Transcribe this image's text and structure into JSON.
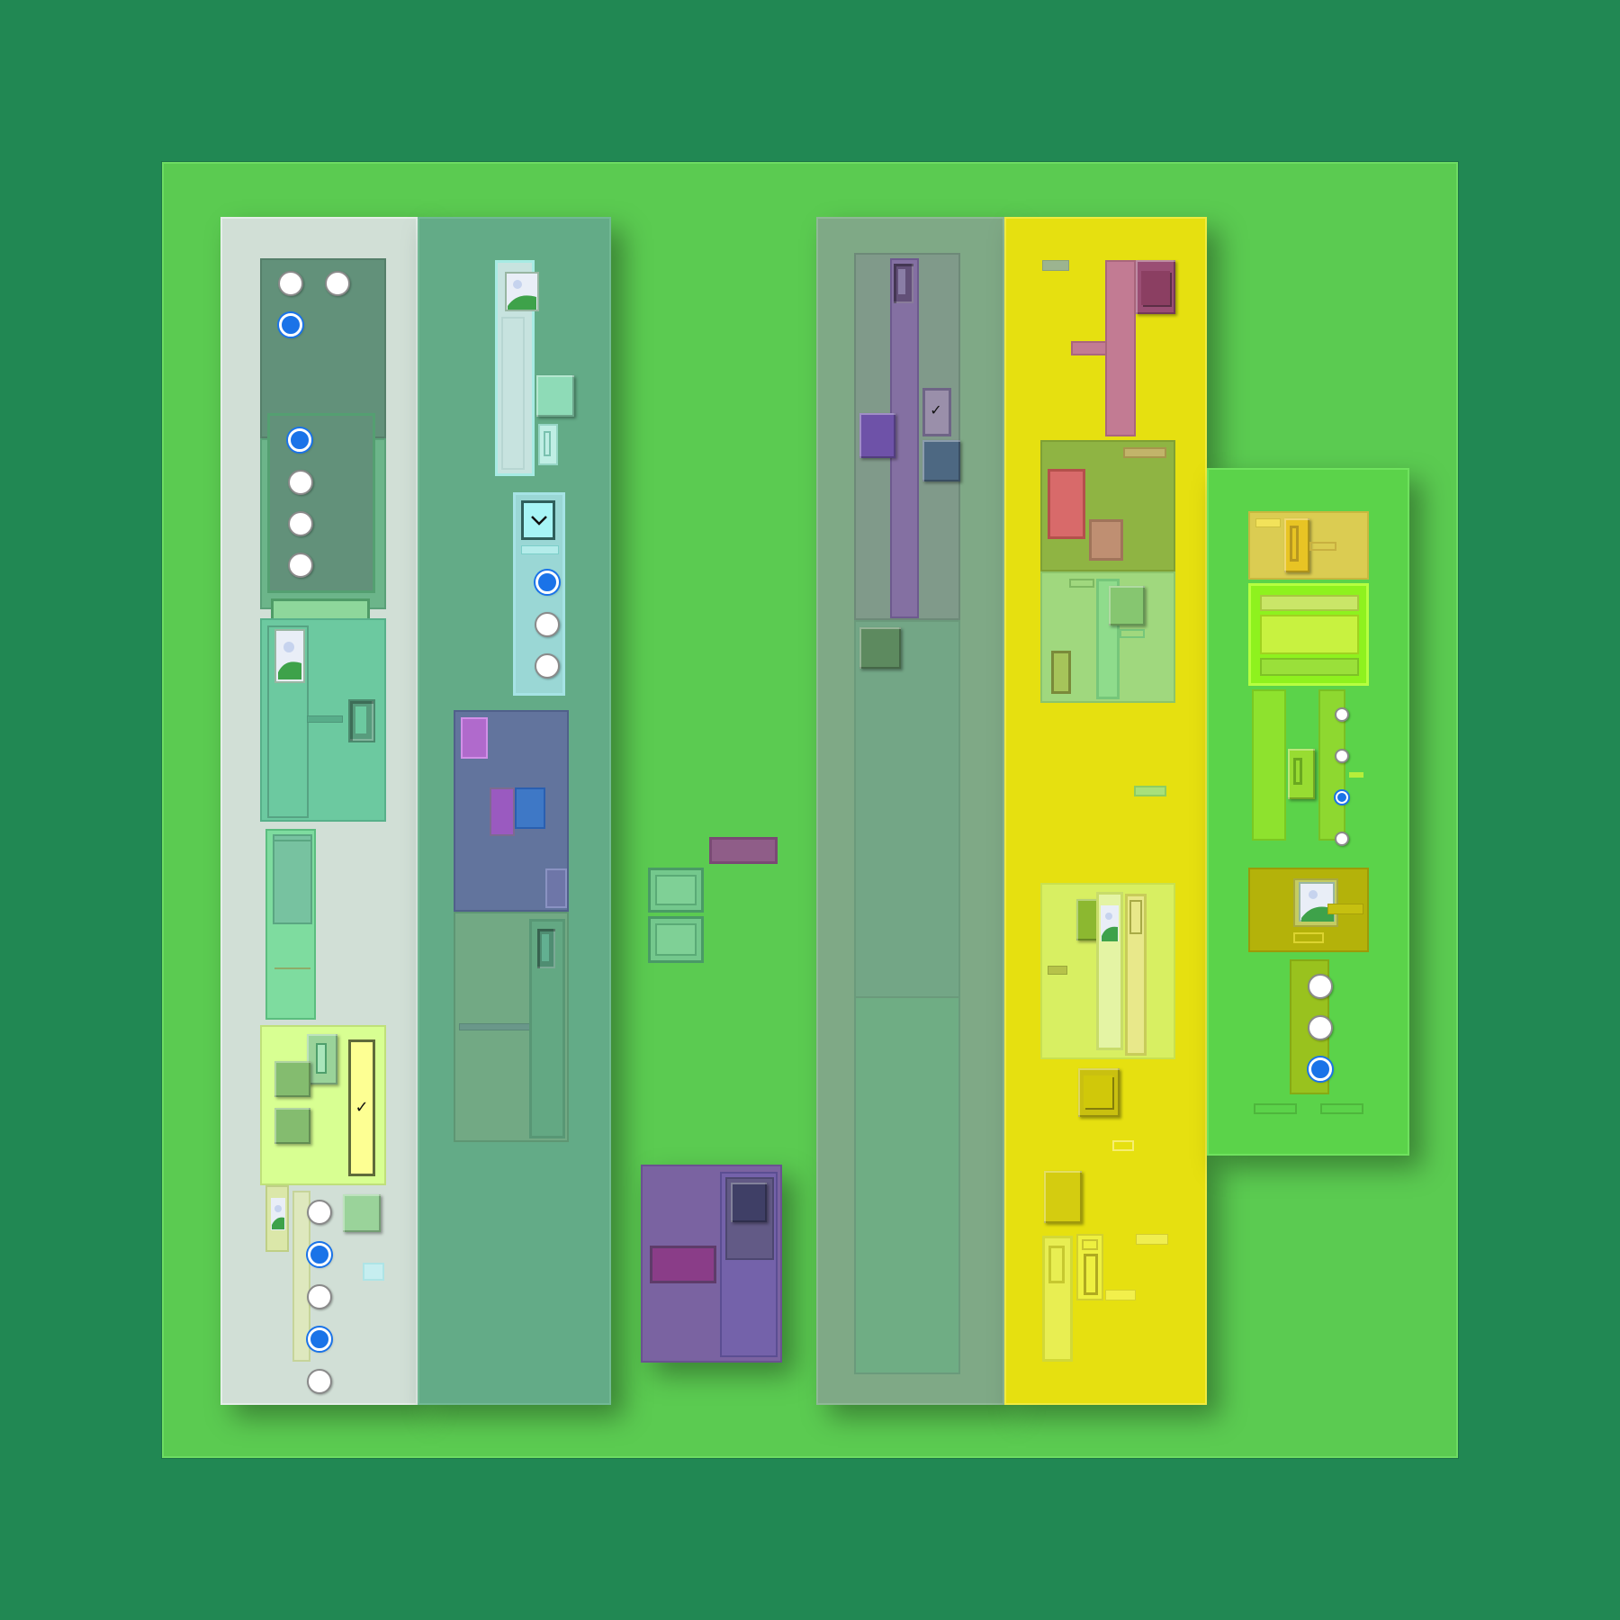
{
  "colors": {
    "background": "#218853",
    "canvas": "#5bcb51",
    "panel_light": "#d1dfd6",
    "panel_teal": "#63ab87",
    "panel_gray": "#7fa986",
    "panel_yellow": "#e6e010",
    "panel_lime": "#5bd34a",
    "radio_selected": "#1a73e8"
  },
  "icons": {
    "image_placeholder": "image-icon",
    "checkmark": "check-icon",
    "dropdown": "chevron-down-icon"
  },
  "groups": {
    "panel1_radios_a": [
      false,
      false,
      true
    ],
    "panel1_radios_b": [
      true,
      false,
      false,
      false
    ],
    "panel1_radios_c": [
      false,
      true,
      false,
      true,
      false
    ],
    "panel2_radios": [
      true,
      false,
      false
    ],
    "panel6_radios_a": [
      false,
      false,
      true,
      false
    ],
    "panel6_radios_b": [
      false,
      false,
      true
    ]
  },
  "checkbox_states": {
    "panel1_checkbox": true,
    "panel4_checkbox": true
  }
}
